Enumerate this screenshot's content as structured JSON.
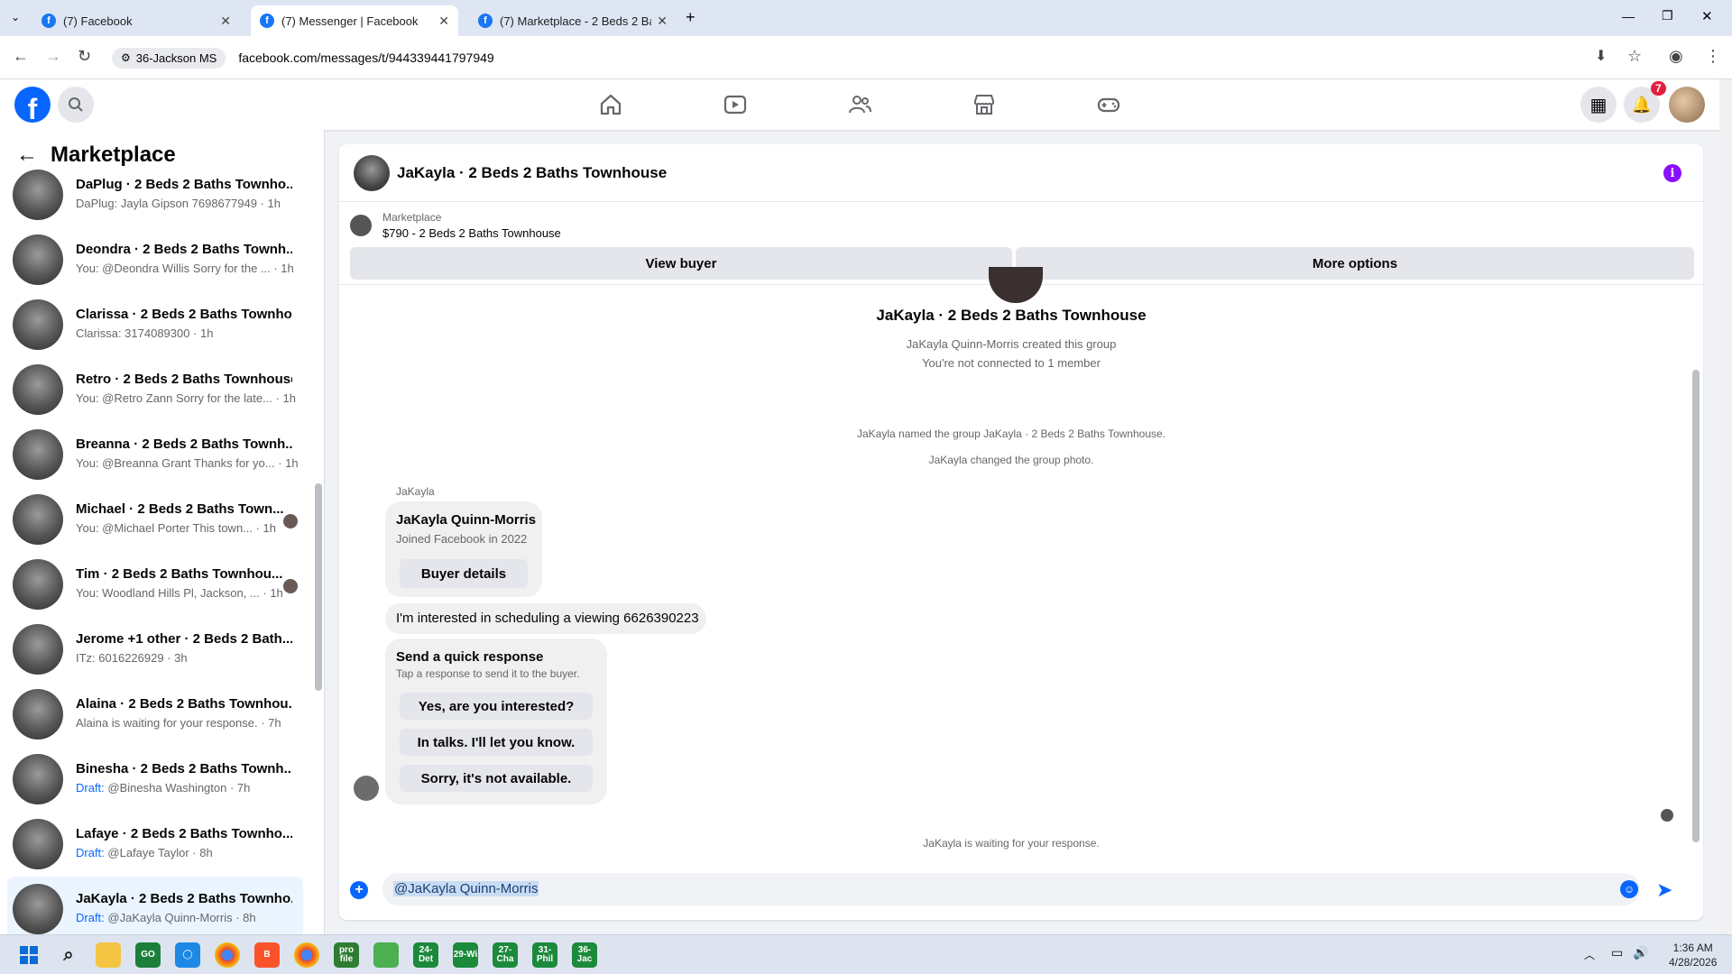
{
  "browser": {
    "tabs": [
      {
        "title": "(7) Facebook",
        "active": false
      },
      {
        "title": "(7) Messenger | Facebook",
        "active": true
      },
      {
        "title": "(7) Marketplace - 2 Beds 2 Bath",
        "active": false
      }
    ],
    "location_chip": "36-Jackson MS",
    "url": "facebook.com/messages/t/944339441797949"
  },
  "header": {
    "notification_count": "7"
  },
  "sidebar": {
    "title": "Marketplace",
    "conversations": [
      {
        "name": "DaPlug · 2 Beds 2 Baths Townho...",
        "preview": "DaPlug: Jayla Gipson 7698677949 · 1h",
        "draft": false
      },
      {
        "name": "Deondra · 2 Beds 2 Baths Townh...",
        "preview": "You: @Deondra Willis Sorry for the ... · 1h",
        "draft": false
      },
      {
        "name": "Clarissa · 2 Beds 2 Baths Townho...",
        "preview": "Clarissa: 3174089300 · 1h",
        "draft": false
      },
      {
        "name": "Retro · 2 Beds 2 Baths Townhouse",
        "preview": "You: @Retro Zann Sorry for the late... · 1h",
        "draft": false
      },
      {
        "name": "Breanna · 2 Beds 2 Baths Townh...",
        "preview": "You: @Breanna Grant Thanks for yo... · 1h",
        "draft": false
      },
      {
        "name": "Michael · 2 Beds 2 Baths Town...",
        "preview": "You: @Michael Porter This town... · 1h",
        "draft": false
      },
      {
        "name": "Tim · 2 Beds 2 Baths Townhou...",
        "preview": "You: Woodland Hills Pl, Jackson, ... · 1h",
        "draft": false
      },
      {
        "name": "Jerome +1 other · 2 Beds 2 Bath...",
        "preview": "ITz: 6016226929 · 3h",
        "draft": false
      },
      {
        "name": "Alaina · 2 Beds 2 Baths Townhou...",
        "preview": "Alaina is waiting for your response. · 7h",
        "draft": false
      },
      {
        "name": "Binesha · 2 Beds 2 Baths Townh...",
        "draft_label": "Draft:",
        "preview": " @Binesha Washington · 7h",
        "draft": true
      },
      {
        "name": "Lafaye · 2 Beds 2 Baths Townho...",
        "draft_label": "Draft:",
        "preview": " @Lafaye Taylor · 8h",
        "draft": true
      },
      {
        "name": "JaKayla · 2 Beds 2 Baths Townho...",
        "draft_label": "Draft:",
        "preview": " @JaKayla Quinn-Morris · 8h",
        "draft": true
      }
    ]
  },
  "chat": {
    "title": "JaKayla · 2 Beds 2 Baths Townhouse",
    "marketplace_label": "Marketplace",
    "listing": "$790 - 2 Beds 2 Baths Townhouse",
    "view_buyer": "View buyer",
    "more_options": "More options",
    "group_name": "JaKayla · 2 Beds 2 Baths Townhouse",
    "created": "JaKayla Quinn-Morris created this group",
    "not_connected": "You're not connected to 1 member",
    "named_event": "JaKayla named the group JaKayla · 2 Beds 2 Baths Townhouse.",
    "photo_event": "JaKayla changed the group photo.",
    "sender": "JaKayla",
    "profile_card": {
      "name": "JaKayla Quinn-Morris",
      "joined": "Joined Facebook in 2022",
      "button": "Buyer details"
    },
    "message": "I'm interested in scheduling a viewing 6626390223",
    "quick_response": {
      "title": "Send a quick response",
      "subtitle": "Tap a response to send it to the buyer.",
      "options": [
        "Yes, are you interested?",
        "In talks. I'll let you know.",
        "Sorry, it's not available."
      ]
    },
    "waiting": "JaKayla is waiting for your response.",
    "composer_text": "@JaKayla Quinn-Morris"
  },
  "taskbar": {
    "time": "1:36 AM",
    "date": "4/28/2026",
    "apps": [
      {
        "label": "pro file",
        "color": "#2e7d32"
      },
      {
        "label": "",
        "color": "#4caf50"
      },
      {
        "label": "24-Det",
        "color": "#1b8a3b"
      },
      {
        "label": "29-Wi",
        "color": "#1b8a3b"
      },
      {
        "label": "27-Cha",
        "color": "#1b8a3b"
      },
      {
        "label": "31-Phil",
        "color": "#1b8a3b"
      },
      {
        "label": "36-Jac",
        "color": "#1b8a3b"
      }
    ]
  }
}
